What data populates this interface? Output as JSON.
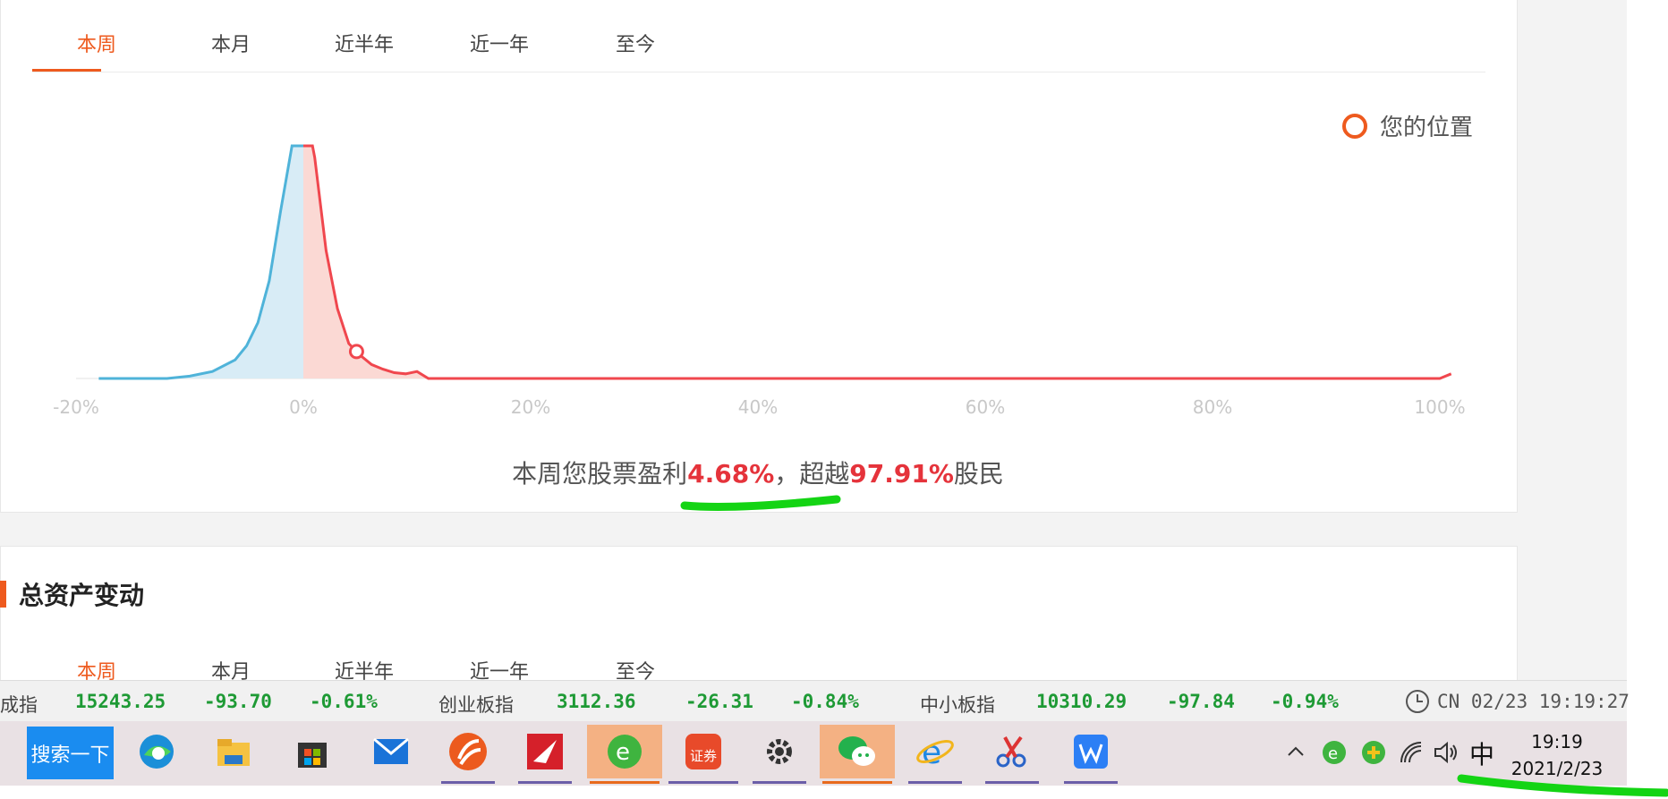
{
  "tabs": [
    "本周",
    "本月",
    "近半年",
    "近一年",
    "至今"
  ],
  "legend": {
    "label": "您的位置"
  },
  "chart_data": {
    "type": "area",
    "x_ticks": [
      "-20%",
      "0%",
      "20%",
      "40%",
      "60%",
      "80%",
      "100%"
    ],
    "xlim": [
      -20,
      100
    ],
    "series_negative_color": "#4fb3d9",
    "series_positive_color": "#f0474e",
    "points": [
      [
        -18,
        0
      ],
      [
        -12,
        0
      ],
      [
        -10,
        0.01
      ],
      [
        -8,
        0.03
      ],
      [
        -6,
        0.08
      ],
      [
        -5,
        0.14
      ],
      [
        -4,
        0.24
      ],
      [
        -3,
        0.42
      ],
      [
        -2,
        0.72
      ],
      [
        -1,
        1
      ],
      [
        0,
        1
      ],
      [
        0.8,
        1
      ],
      [
        1,
        0.95
      ],
      [
        2,
        0.55
      ],
      [
        3,
        0.3
      ],
      [
        4,
        0.15
      ],
      [
        5,
        0.1
      ],
      [
        6,
        0.06
      ],
      [
        7,
        0.04
      ],
      [
        8,
        0.025
      ],
      [
        9,
        0.02
      ],
      [
        10,
        0.03
      ],
      [
        11,
        0
      ],
      [
        100,
        0
      ],
      [
        101,
        0.02
      ]
    ],
    "your_position": 4.68
  },
  "summary": {
    "pre": "本周您股票盈利",
    "profit": "4.68%",
    "mid": "，超越",
    "beat": "97.91%",
    "post": "股民"
  },
  "section": {
    "title": "总资产变动"
  },
  "tabs2": [
    "本周",
    "本月",
    "近半年",
    "近一年",
    "至今"
  ],
  "ticker": {
    "items": [
      {
        "name": "成指",
        "value": "15243.25",
        "change": "-93.70",
        "pct": "-0.61%"
      },
      {
        "name": "创业板指",
        "value": "3112.36",
        "change": "-26.31",
        "pct": "-0.84%"
      },
      {
        "name": "中小板指",
        "value": "10310.29",
        "change": "-97.84",
        "pct": "-0.94%"
      }
    ],
    "clock": "CN 02/23 19:19:27"
  },
  "taskbar": {
    "search_label": "搜索一下",
    "icons": [
      "edge-icon",
      "file-explorer-icon",
      "store-icon",
      "mail-icon",
      "app-orange-icon",
      "app-red-icon",
      "browser-green-icon",
      "securities-app-icon",
      "settings-icon",
      "wechat-icon",
      "ie-icon",
      "snip-tool-icon",
      "wps-icon"
    ],
    "ime": "中",
    "time": "19:19",
    "date": "2021/2/23"
  }
}
